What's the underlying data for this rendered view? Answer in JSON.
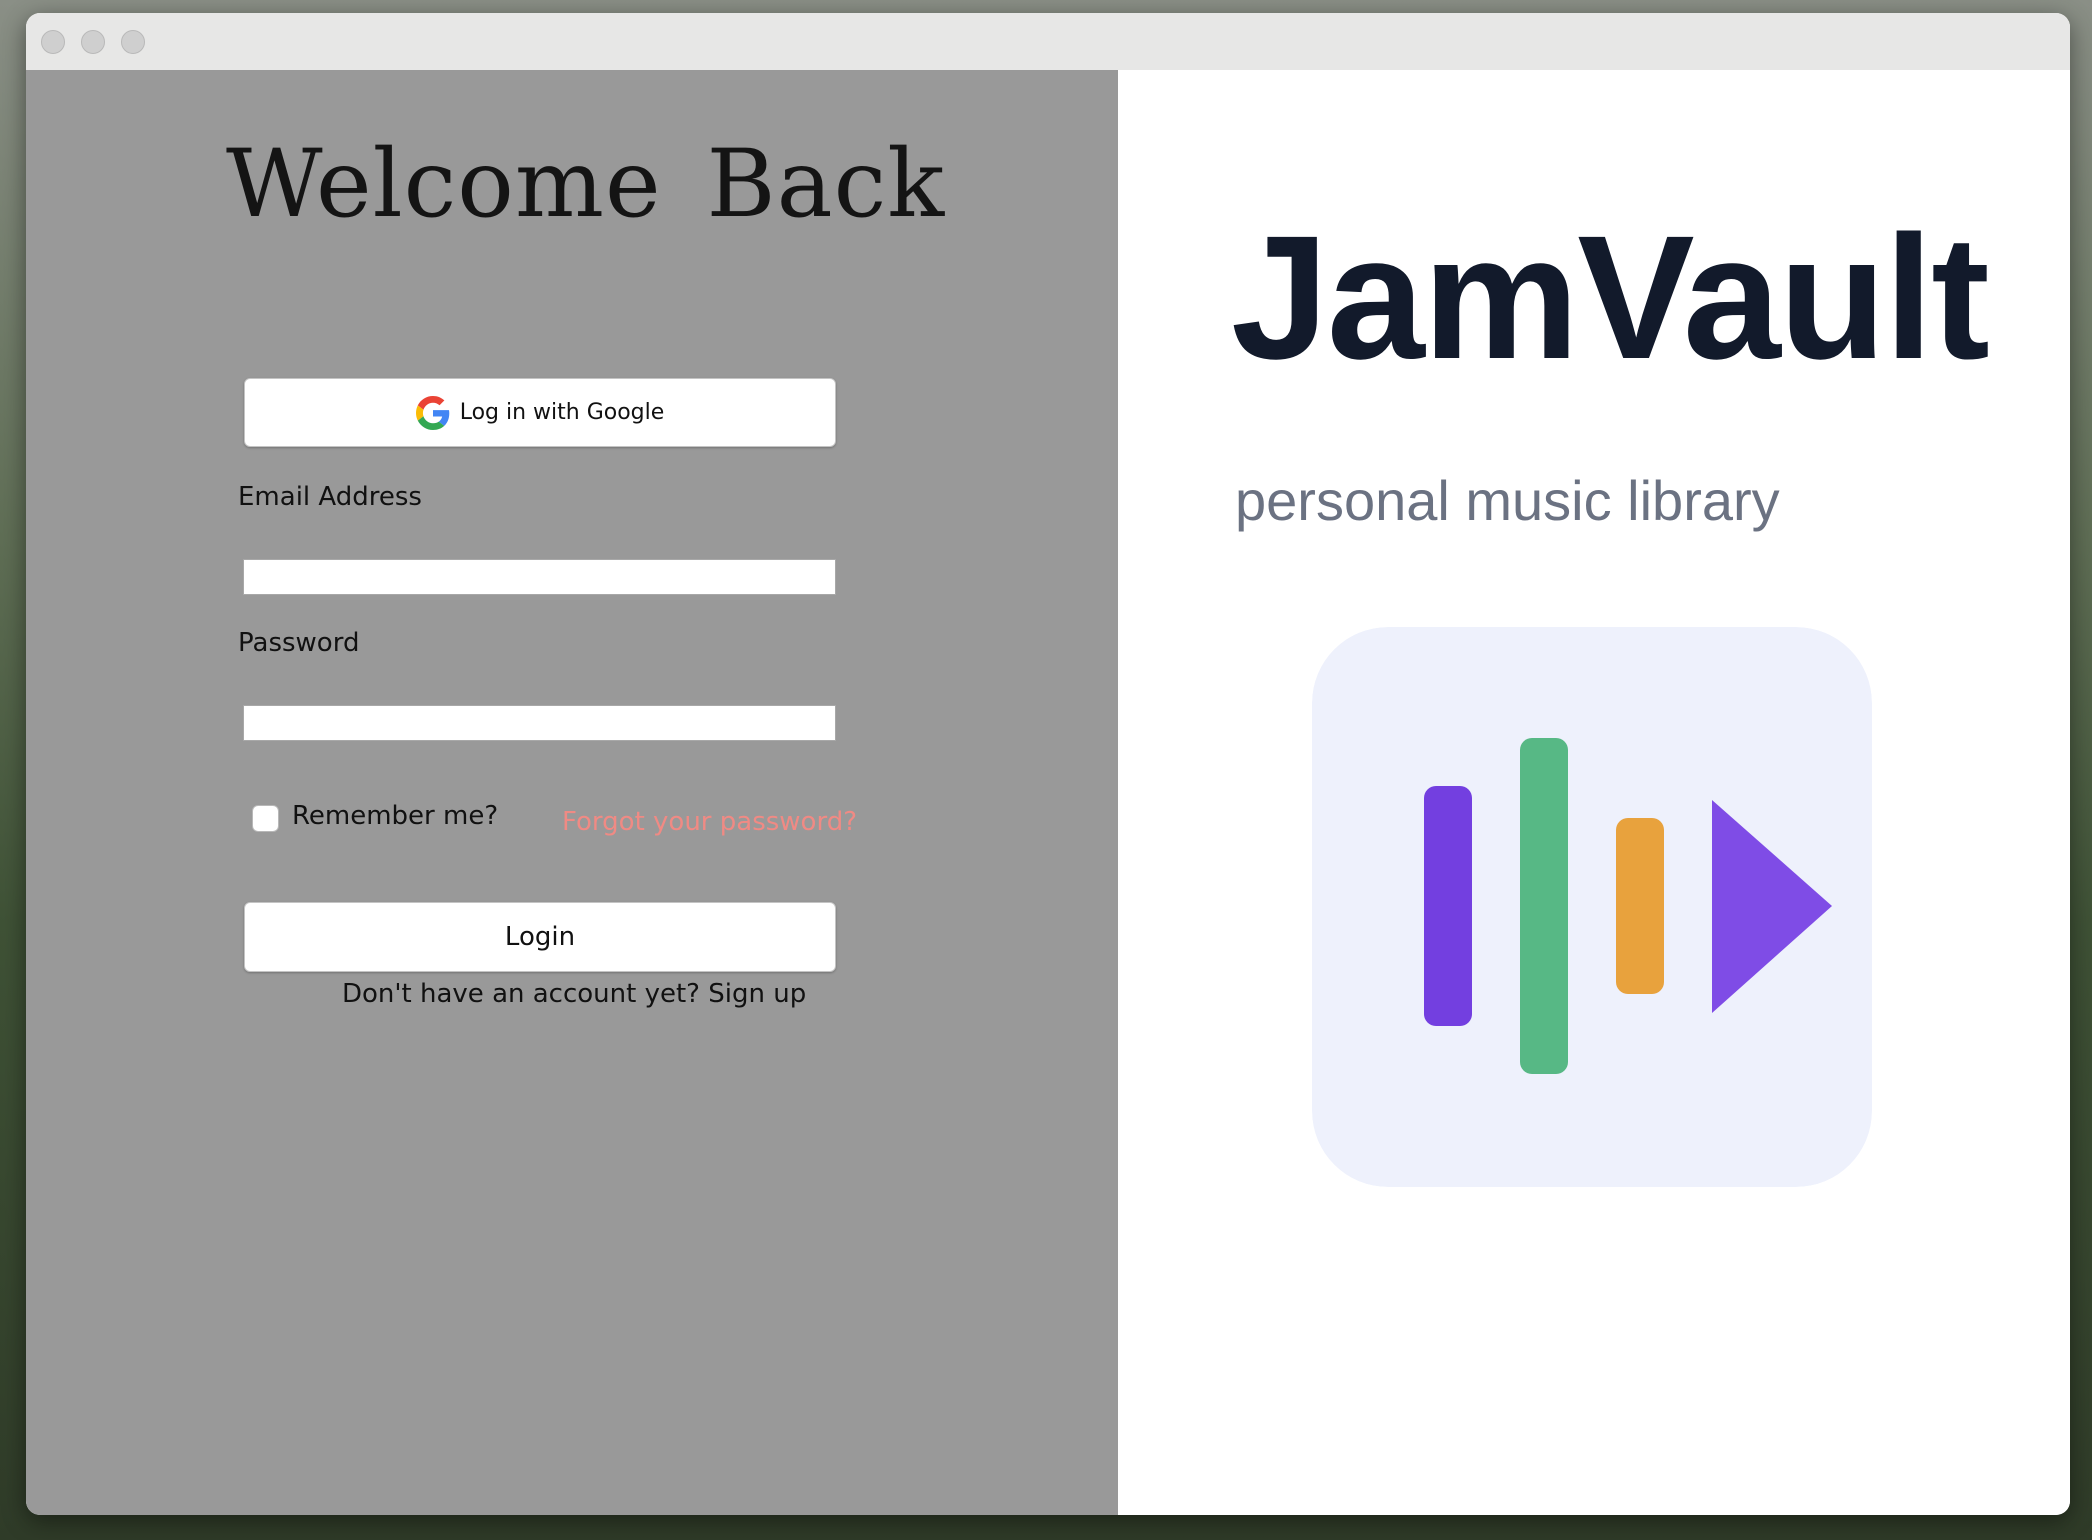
{
  "login": {
    "heading": "Welcome Back",
    "google_button_label": "Log in with Google",
    "email_label": "Email Address",
    "email_value": "",
    "password_label": "Password",
    "password_value": "",
    "remember_label": "Remember me?",
    "remember_checked": false,
    "forgot_link": "Forgot your password?",
    "login_button_label": "Login",
    "signup_prompt": "Don't have an account yet? Sign up"
  },
  "brand": {
    "name": "JamVault",
    "tagline": "personal music library",
    "logo_icon": "equalizer-play-logo",
    "colors": {
      "tile": "#eef1fc",
      "bar_purple": "#733fe0",
      "bar_green": "#57b885",
      "bar_orange": "#e8a23d",
      "play": "#7f4ce6"
    }
  },
  "colors": {
    "left_panel": "#999999",
    "right_panel": "#ffffff",
    "forgot_link": "#f08a84",
    "brand_text": "#121a2b",
    "tagline_text": "#6b7282"
  }
}
